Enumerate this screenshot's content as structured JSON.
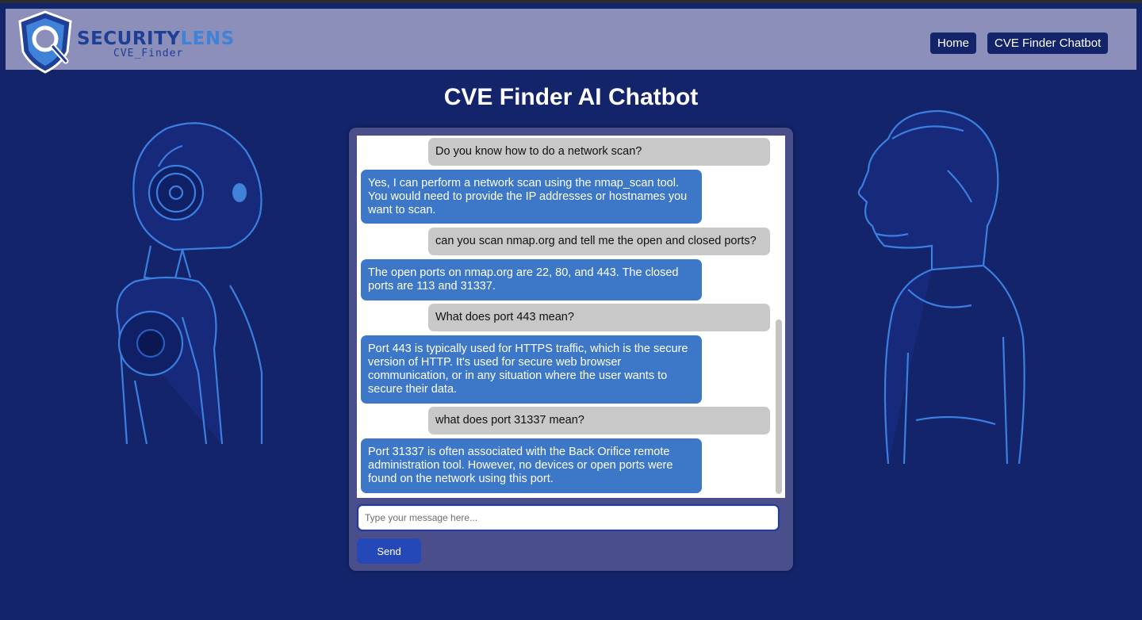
{
  "brand": {
    "name_part1": "SECURITY",
    "name_part2": "LENS",
    "subtitle": "CVE_Finder"
  },
  "nav": {
    "items": [
      {
        "label": "Home"
      },
      {
        "label": "CVE Finder Chatbot"
      }
    ]
  },
  "page": {
    "title": "CVE Finder AI Chatbot"
  },
  "chat": {
    "messages": [
      {
        "sender": "user",
        "text": "Do you know how to do a network scan?"
      },
      {
        "sender": "bot",
        "text": "Yes, I can perform a network scan using the nmap_scan tool. You would need to provide the IP addresses or hostnames you want to scan."
      },
      {
        "sender": "user",
        "text": "can you scan nmap.org and tell me the open and closed ports?"
      },
      {
        "sender": "bot",
        "text": "The open ports on nmap.org are 22, 80, and 443. The closed ports are 113 and 31337."
      },
      {
        "sender": "user",
        "text": "What does port 443 mean?"
      },
      {
        "sender": "bot",
        "text": "Port 443 is typically used for HTTPS traffic, which is the secure version of HTTP. It's used for secure web browser communication, or in any situation where the user wants to secure their data."
      },
      {
        "sender": "user",
        "text": "what does port 31337 mean?"
      },
      {
        "sender": "bot",
        "text": "Port 31337 is often associated with the Back Orifice remote administration tool. However, no devices or open ports were found on the network using this port."
      }
    ],
    "input": {
      "value": "",
      "placeholder": "Type your message here..."
    },
    "send_label": "Send"
  },
  "colors": {
    "background": "#13246a",
    "header": "#8b8fb9",
    "panel": "#4a4f8b",
    "user_bubble": "#c8c8c8",
    "bot_bubble": "#3d78c8",
    "send_button": "#2448b8",
    "illustration_line": "#3b7fe0"
  },
  "icons": {
    "logo": "shield-magnifier-icon",
    "left_illustration": "robot-illustration",
    "right_illustration": "human-profile-illustration"
  }
}
